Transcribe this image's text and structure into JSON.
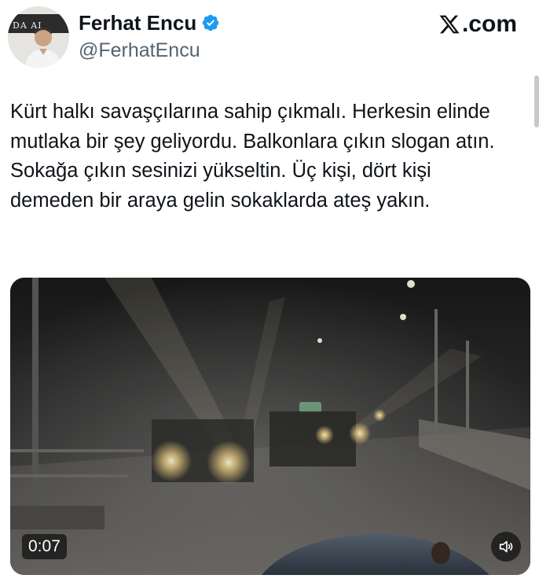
{
  "author": {
    "display_name": "Ferhat Encu",
    "handle": "@FerhatEncu",
    "verified": true,
    "avatar_text": "DA  AI"
  },
  "brand": {
    "label": ".com",
    "icon": "x-logo-icon"
  },
  "tweet": {
    "text": "Kürt halkı savaşçılarına sahip çıkmalı. Herkesin elinde mutlaka bir şey geliyordu. Balkonlara çıkın slogan atın. Sokağa çıkın sesinizi yükseltin. Üç kişi, dört kişi demeden bir araya gelin sokaklarda ateş yakın."
  },
  "media": {
    "type": "video",
    "duration": "0:07",
    "sound_icon": "speaker-icon"
  },
  "colors": {
    "text": "#0f1419",
    "secondary": "#536471",
    "verified": "#1d9bf0"
  }
}
